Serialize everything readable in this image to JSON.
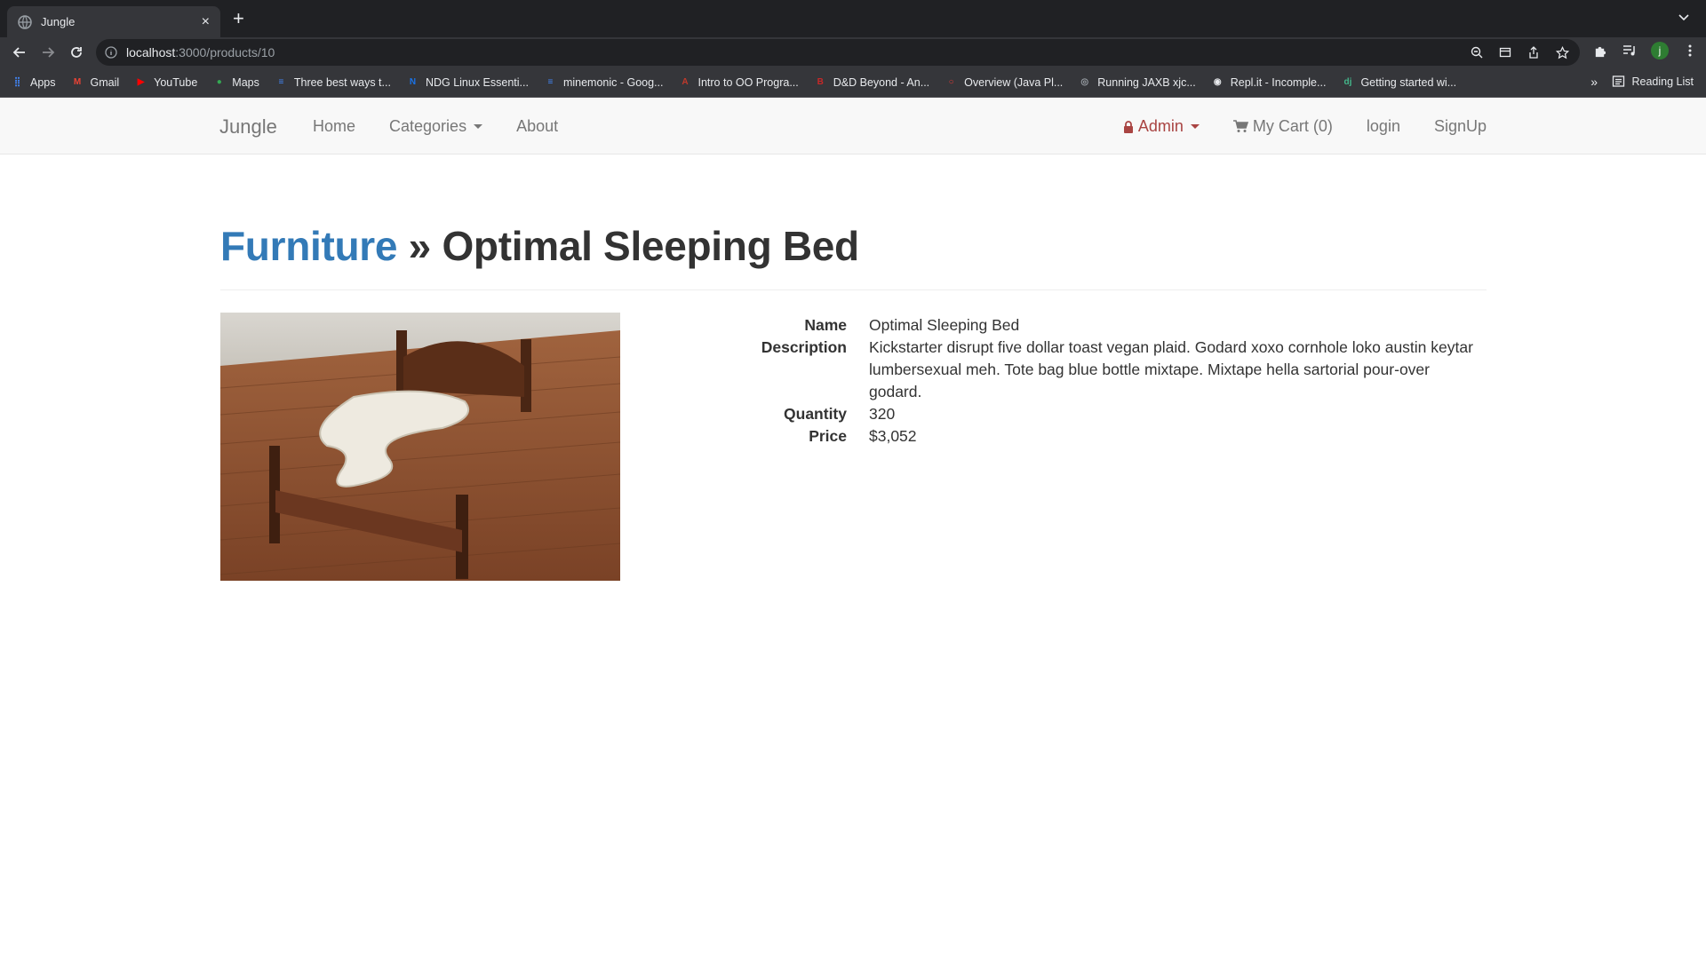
{
  "browser": {
    "tab_title": "Jungle",
    "url_host": "localhost",
    "url_path": ":3000/products/10",
    "bookmarks": [
      {
        "label": "Apps",
        "icon": "apps-grid-icon"
      },
      {
        "label": "Gmail",
        "icon": "gmail-icon"
      },
      {
        "label": "YouTube",
        "icon": "youtube-icon"
      },
      {
        "label": "Maps",
        "icon": "maps-pin-icon"
      },
      {
        "label": "Three best ways t...",
        "icon": "docs-icon"
      },
      {
        "label": "NDG Linux Essenti...",
        "icon": "ndg-icon"
      },
      {
        "label": "minemonic - Goog...",
        "icon": "docs-icon"
      },
      {
        "label": "Intro to OO Progra...",
        "icon": "page-icon"
      },
      {
        "label": "D&D Beyond - An...",
        "icon": "dndbeyond-icon"
      },
      {
        "label": "Overview (Java Pl...",
        "icon": "oracle-icon"
      },
      {
        "label": "Running JAXB xjc...",
        "icon": "globe-icon"
      },
      {
        "label": "Repl.it - Incomple...",
        "icon": "replit-icon"
      },
      {
        "label": "Getting started wi...",
        "icon": "django-icon"
      }
    ],
    "reading_list": "Reading List",
    "profile_initial": "j"
  },
  "navbar": {
    "brand": "Jungle",
    "home": "Home",
    "categories": "Categories",
    "about": "About",
    "admin": "Admin",
    "cart": "My Cart (0)",
    "login": "login",
    "signup": "SignUp"
  },
  "product": {
    "category": "Furniture",
    "separator": " » ",
    "title": "Optimal Sleeping Bed",
    "image_alt": "Optimal Sleeping Bed",
    "fields": {
      "name_label": "Name",
      "name": "Optimal Sleeping Bed",
      "description_label": "Description",
      "description": "Kickstarter disrupt five dollar toast vegan plaid. Godard xoxo cornhole loko austin keytar lumbersexual meh. Tote bag blue bottle mixtape. Mixtape hella sartorial pour-over godard.",
      "quantity_label": "Quantity",
      "quantity": "320",
      "price_label": "Price",
      "price": "$3,052"
    }
  },
  "colors": {
    "link": "#337ab7",
    "admin": "#a94442",
    "nav_text": "#777777"
  }
}
